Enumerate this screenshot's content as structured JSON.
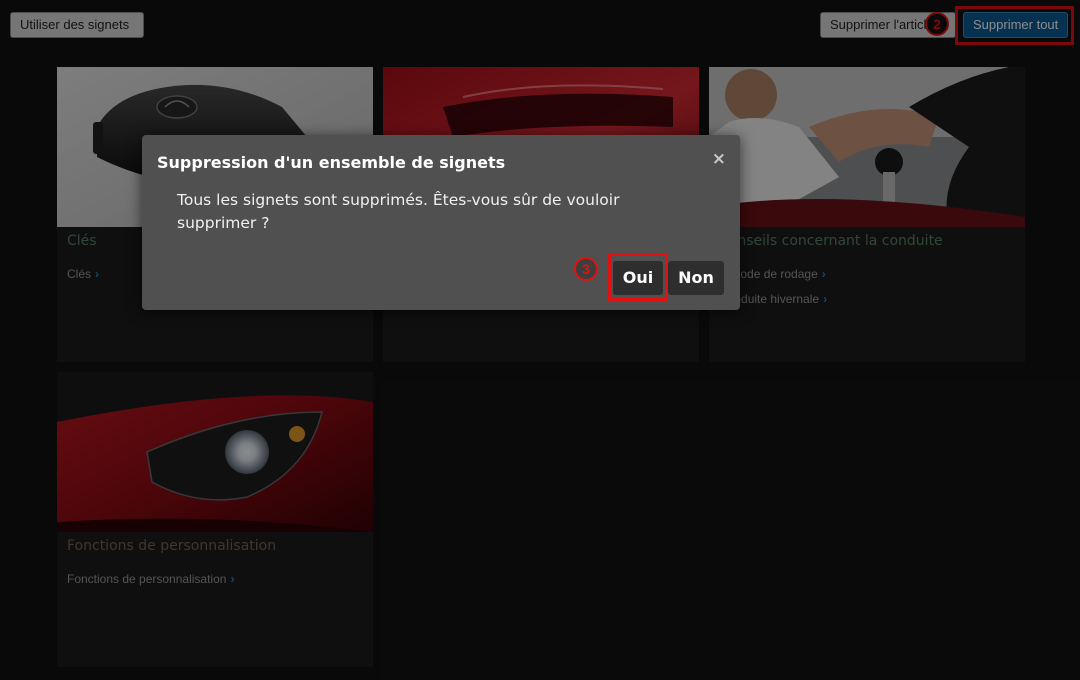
{
  "toolbar": {
    "use_bookmarks": "Utiliser des signets",
    "delete_article": "Supprimer l'article",
    "delete_all": "Supprimer tout",
    "marker_2": "2"
  },
  "cards": [
    {
      "title": "Clés",
      "links": [
        "Clés"
      ]
    },
    {
      "title": "",
      "links": []
    },
    {
      "title": "Conseils concernant la conduite",
      "links": [
        "Période de rodage",
        "Conduite hivernale"
      ]
    },
    {
      "title": "Fonctions de personnalisation",
      "links": [
        "Fonctions de personnalisation"
      ]
    }
  ],
  "dialog": {
    "title": "Suppression d'un ensemble de signets",
    "message": "Tous les signets sont supprimés. Êtes-vous sûr de vouloir supprimer ?",
    "yes": "Oui",
    "no": "Non",
    "close": "×",
    "marker_3": "3"
  },
  "colors": {
    "background": "#121212",
    "dialog_bg": "#505050",
    "accent_blue": "#0b5a92",
    "highlight_red": "#e21111",
    "card_title_green": "#5a8266",
    "card_title_brown": "#7a634d"
  },
  "icons": {
    "link_chevron": "chevron-right-icon",
    "close": "close-icon"
  }
}
